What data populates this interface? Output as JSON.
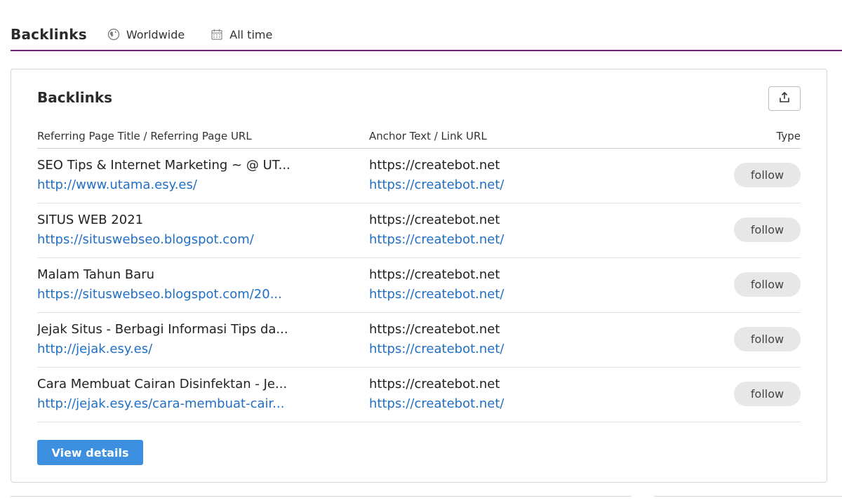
{
  "header": {
    "title": "Backlinks",
    "filters": [
      {
        "label": "Worldwide",
        "icon": "globe-icon"
      },
      {
        "label": "All time",
        "icon": "calendar-icon"
      }
    ]
  },
  "card": {
    "title": "Backlinks",
    "export_icon": "export-icon",
    "columns": {
      "referring": "Referring Page Title / Referring Page URL",
      "anchor": "Anchor Text / Link URL",
      "type": "Type"
    },
    "rows": [
      {
        "title": "SEO Tips & Internet Marketing ~ @ UT...",
        "url": "http://www.utama.esy.es/",
        "anchor_text": "https://createbot.net",
        "link_url": "https://createbot.net/",
        "type": "follow"
      },
      {
        "title": "SITUS WEB 2021",
        "url": "https://situswebseo.blogspot.com/",
        "anchor_text": "https://createbot.net",
        "link_url": "https://createbot.net/",
        "type": "follow"
      },
      {
        "title": "Malam Tahun Baru",
        "url": "https://situswebseo.blogspot.com/20...",
        "anchor_text": "https://createbot.net",
        "link_url": "https://createbot.net/",
        "type": "follow"
      },
      {
        "title": "Jejak Situs - Berbagi Informasi Tips da...",
        "url": "http://jejak.esy.es/",
        "anchor_text": "https://createbot.net",
        "link_url": "https://createbot.net/",
        "type": "follow"
      },
      {
        "title": "Cara Membuat Cairan Disinfektan - Je...",
        "url": "http://jejak.esy.es/cara-membuat-cair...",
        "anchor_text": "https://createbot.net",
        "link_url": "https://createbot.net/",
        "type": "follow"
      }
    ],
    "view_details_label": "View details"
  },
  "colors": {
    "accent_rule": "#7b1d84",
    "link": "#1f6fc4",
    "primary_button": "#3d8fe0",
    "badge_bg": "#e7e7e7"
  }
}
